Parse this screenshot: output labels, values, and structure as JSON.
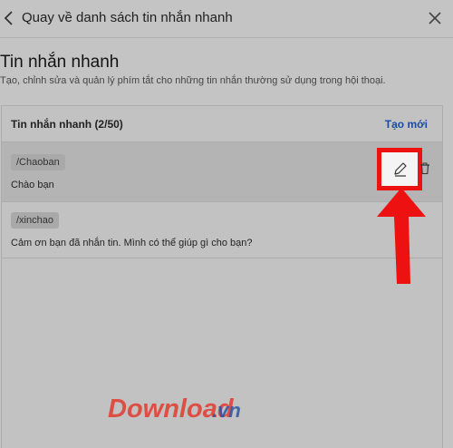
{
  "header": {
    "title": "Quay về danh sách tin nhắn nhanh",
    "back_icon": "chevron-left-icon",
    "close_icon": "close-icon"
  },
  "page": {
    "title": "Tin nhắn nhanh",
    "description": "Tạo, chỉnh sửa và quản lý phím tắt cho những tin nhắn thường sử dụng trong hội thoại."
  },
  "panel": {
    "title": "Tin nhắn nhanh (2/50)",
    "new_label": "Tạo mới"
  },
  "quick_messages": [
    {
      "shortcut": "/Chaoban",
      "message": "Chào bạn"
    },
    {
      "shortcut": "/xinchao",
      "message": "Cảm ơn bạn đã nhắn tin. Mình có thể giúp gì cho bạn?"
    }
  ],
  "icons": {
    "edit": "pencil-icon",
    "delete": "trash-icon",
    "annotation": "red-arrow-icon"
  },
  "colors": {
    "accent": "#1a4ba8",
    "highlight": "#ee1111",
    "background": "#c4c4c4",
    "watermark_red": "#e23b2e",
    "watermark_blue": "#2a55a6"
  },
  "watermark": {
    "brand": "Download",
    "domain": ".vn"
  }
}
